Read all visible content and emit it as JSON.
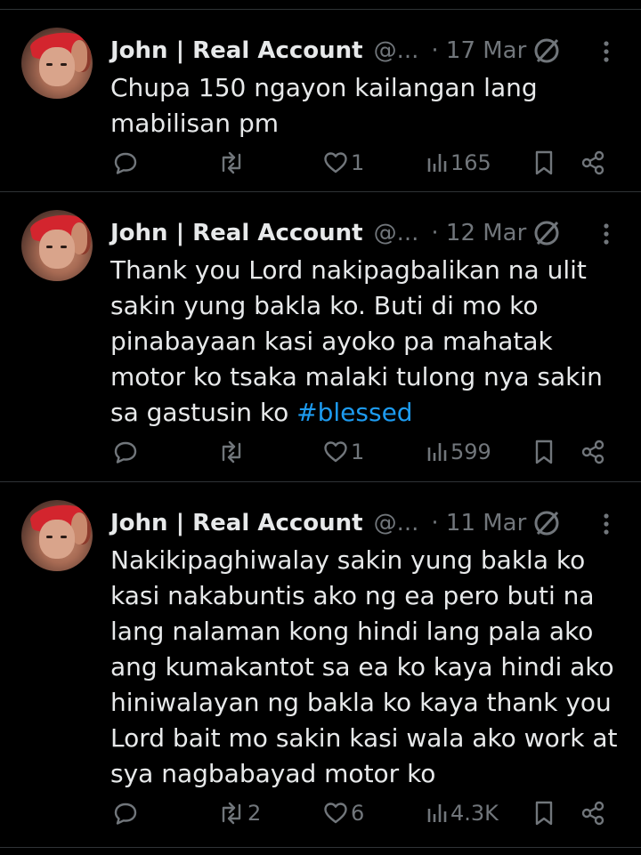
{
  "colors": {
    "background": "#000000",
    "text": "#e7e9ea",
    "muted": "#71767b",
    "link": "#1d9bf0",
    "divider": "#2f3336",
    "avatar_cap": "#d3252e"
  },
  "tweets": [
    {
      "author_name": "John | Real Account",
      "handle": "@...",
      "date": "· 17 Mar",
      "body_text": "Chupa 150 ngayon kailangan lang mabilisan pm",
      "hashtag": "",
      "reply_count": "",
      "retweet_count": "",
      "like_count": "1",
      "view_count": "165",
      "icons": [
        "reply-icon",
        "retweet-icon",
        "heart-icon",
        "views-icon",
        "bookmark-icon",
        "share-icon",
        "cancel-icon",
        "more-icon"
      ]
    },
    {
      "author_name": "John | Real Account",
      "handle": "@...",
      "date": "· 12 Mar",
      "body_text": "Thank you Lord nakipagbalikan na ulit sakin yung bakla ko. Buti di mo ko pinabayaan kasi ayoko pa mahatak motor ko tsaka malaki tulong nya sakin sa gastusin ko ",
      "hashtag": "#blessed",
      "reply_count": "",
      "retweet_count": "",
      "like_count": "1",
      "view_count": "599",
      "icons": [
        "reply-icon",
        "retweet-icon",
        "heart-icon",
        "views-icon",
        "bookmark-icon",
        "share-icon",
        "cancel-icon",
        "more-icon"
      ]
    },
    {
      "author_name": "John | Real Account",
      "handle": "@...",
      "date": "· 11 Mar",
      "body_text": "Nakikipaghiwalay sakin yung bakla ko kasi nakabuntis ako ng ea pero buti na lang nalaman kong hindi lang pala ako ang kumakantot sa ea ko kaya hindi ako hiniwalayan ng bakla ko kaya thank you Lord bait mo sakin kasi wala ako work at sya nagbabayad motor ko",
      "hashtag": "",
      "reply_count": "",
      "retweet_count": "2",
      "like_count": "6",
      "view_count": "4.3K",
      "icons": [
        "reply-icon",
        "retweet-icon",
        "heart-icon",
        "views-icon",
        "bookmark-icon",
        "share-icon",
        "cancel-icon",
        "more-icon"
      ]
    }
  ]
}
